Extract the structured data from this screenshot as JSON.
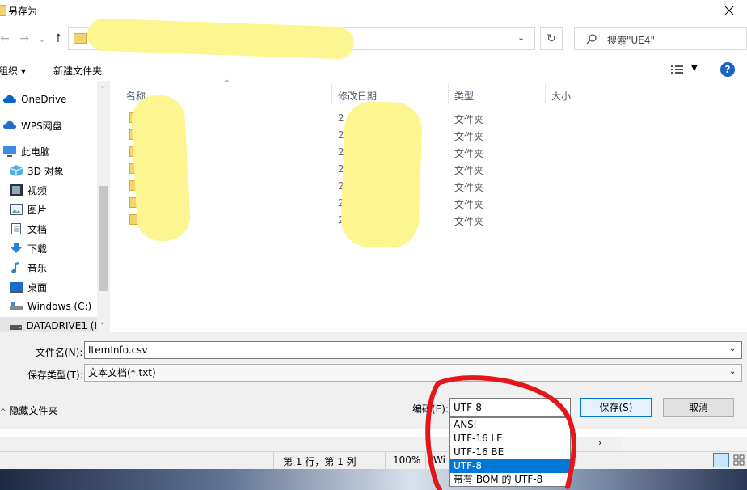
{
  "window": {
    "title": "另存为"
  },
  "nav": {
    "back": "←",
    "forward": "→",
    "up": "↑",
    "recent": "⌄"
  },
  "address": {
    "path": "",
    "dropdown": "⌄",
    "refresh": "↻"
  },
  "search": {
    "placeholder": "搜索\"UE4\""
  },
  "toolbar": {
    "organize": "组织 ▾",
    "new_folder": "新建文件夹",
    "view_caret": "▼",
    "help": "?"
  },
  "sidebar": {
    "items": [
      {
        "label": "OneDrive",
        "icon": "cloud-icon"
      },
      {
        "label": "WPS网盘",
        "icon": "cloud-icon"
      },
      {
        "label": "此电脑",
        "icon": "computer-icon"
      },
      {
        "label": "3D 对象",
        "icon": "cube-icon"
      },
      {
        "label": "视频",
        "icon": "video-icon"
      },
      {
        "label": "图片",
        "icon": "picture-icon"
      },
      {
        "label": "文档",
        "icon": "document-icon"
      },
      {
        "label": "下载",
        "icon": "download-icon"
      },
      {
        "label": "音乐",
        "icon": "music-icon"
      },
      {
        "label": "桌面",
        "icon": "desktop-icon"
      },
      {
        "label": "Windows  (C:)",
        "icon": "drive-icon"
      },
      {
        "label": "DATADRIVE1 (I",
        "icon": "drive-icon"
      }
    ]
  },
  "columns": {
    "name": "名称",
    "date": "修改日期",
    "type": "类型",
    "size": "大小"
  },
  "files": [
    {
      "date": "2",
      "type": "文件夹"
    },
    {
      "date": "2",
      "type": "文件夹"
    },
    {
      "date": "2",
      "type": "文件夹"
    },
    {
      "date": "2",
      "type": "文件夹"
    },
    {
      "date": "2",
      "type": "文件夹"
    },
    {
      "date": "2",
      "type": "文件夹"
    },
    {
      "date": "2(",
      "type": "文件夹"
    }
  ],
  "form": {
    "filename_label": "文件名(N):",
    "filename_value": "ItemInfo.csv",
    "filetype_label": "保存类型(T):",
    "filetype_value": "文本文档(*.txt)",
    "hide_folders": "隐藏文件夹",
    "encoding_label": "编码(E):",
    "encoding_value": "UTF-8",
    "save": "保存(S)",
    "cancel": "取消"
  },
  "encoding_options": [
    "ANSI",
    "UTF-16 LE",
    "UTF-16 BE",
    "UTF-8",
    "带有 BOM 的 UTF-8"
  ],
  "encoding_selected_index": 3,
  "status": {
    "position": "第 1 行，第 1 列",
    "zoom": "100%",
    "line_ending": "Wi"
  },
  "colors": {
    "accent": "#0078d7",
    "annotation": "#e3161b",
    "redaction": "#fdf58f",
    "folder": "#f4d36c"
  }
}
